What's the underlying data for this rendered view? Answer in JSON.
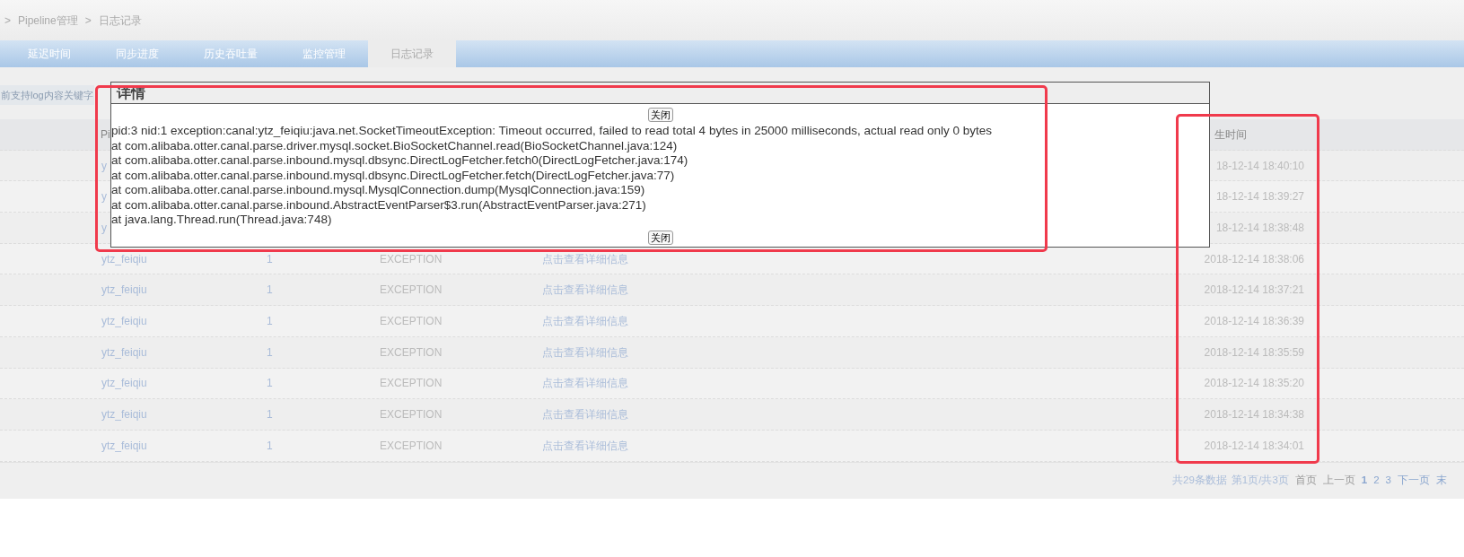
{
  "breadcrumb": [
    {
      "separator": ">",
      "label": "Pipeline管理"
    },
    {
      "separator": ">",
      "label": "日志记录"
    }
  ],
  "tabs": [
    {
      "label": "延迟时间",
      "selected": false
    },
    {
      "label": "同步进度",
      "selected": false
    },
    {
      "label": "历史吞吐量",
      "selected": false
    },
    {
      "label": "监控管理",
      "selected": false
    },
    {
      "label": "日志记录",
      "selected": true
    }
  ],
  "search_hint": "前支持log内容关键字",
  "table": {
    "columns": {
      "pipeline": "Pi",
      "time": "生时间"
    },
    "rows": [
      {
        "pipeline": "y",
        "time": "18-12-14 18:40:10"
      },
      {
        "pipeline": "y",
        "time": "18-12-14 18:39:27"
      },
      {
        "pipeline": "y",
        "time": "18-12-14 18:38:48"
      },
      {
        "pipeline": "ytz_feiqiu",
        "column_3": "1",
        "type": "EXCEPTION",
        "detail_link": "点击查看详细信息",
        "time": "2018-12-14 18:38:06"
      },
      {
        "pipeline": "ytz_feiqiu",
        "column_3": "1",
        "type": "EXCEPTION",
        "detail_link": "点击查看详细信息",
        "time": "2018-12-14 18:37:21"
      },
      {
        "pipeline": "ytz_feiqiu",
        "column_3": "1",
        "type": "EXCEPTION",
        "detail_link": "点击查看详细信息",
        "time": "2018-12-14 18:36:39"
      },
      {
        "pipeline": "ytz_feiqiu",
        "column_3": "1",
        "type": "EXCEPTION",
        "detail_link": "点击查看详细信息",
        "time": "2018-12-14 18:35:59"
      },
      {
        "pipeline": "ytz_feiqiu",
        "column_3": "1",
        "type": "EXCEPTION",
        "detail_link": "点击查看详细信息",
        "time": "2018-12-14 18:35:20"
      },
      {
        "pipeline": "ytz_feiqiu",
        "column_3": "1",
        "type": "EXCEPTION",
        "detail_link": "点击查看详细信息",
        "time": "2018-12-14 18:34:38"
      },
      {
        "pipeline": "ytz_feiqiu",
        "column_3": "1",
        "type": "EXCEPTION",
        "detail_link": "点击查看详细信息",
        "time": "2018-12-14 18:34:01"
      }
    ]
  },
  "pagination": {
    "summary": "共29条数据",
    "page_info": "第1页/共3页",
    "links": [
      {
        "label": "首页",
        "disabled": true,
        "selected": false
      },
      {
        "label": "上一页",
        "disabled": true,
        "selected": false
      },
      {
        "label": "1",
        "disabled": false,
        "selected": true
      },
      {
        "label": "2",
        "disabled": false,
        "selected": false
      },
      {
        "label": "3",
        "disabled": false,
        "selected": false
      },
      {
        "label": "下一页",
        "disabled": false,
        "selected": false
      },
      {
        "label": "末",
        "disabled": false,
        "selected": false
      }
    ]
  },
  "dialog": {
    "title": "详情",
    "close_buttons": [
      "关闭",
      "关闭"
    ],
    "lines": [
      "pid:3 nid:1 exception:canal:ytz_feiqiu:java.net.SocketTimeoutException: Timeout occurred, failed to read total 4 bytes in 25000 milliseconds, actual read only 0 bytes",
      "at com.alibaba.otter.canal.parse.driver.mysql.socket.BioSocketChannel.read(BioSocketChannel.java:124)",
      "at com.alibaba.otter.canal.parse.inbound.mysql.dbsync.DirectLogFetcher.fetch0(DirectLogFetcher.java:174)",
      "at com.alibaba.otter.canal.parse.inbound.mysql.dbsync.DirectLogFetcher.fetch(DirectLogFetcher.java:77)",
      "at com.alibaba.otter.canal.parse.inbound.mysql.MysqlConnection.dump(MysqlConnection.java:159)",
      "at com.alibaba.otter.canal.parse.inbound.AbstractEventParser$3.run(AbstractEventParser.java:271)",
      "at java.lang.Thread.run(Thread.java:748)"
    ]
  }
}
